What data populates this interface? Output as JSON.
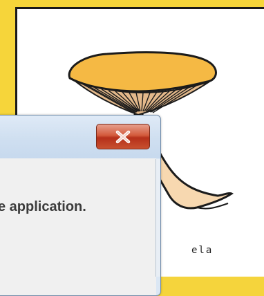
{
  "background": {
    "color": "#f6d53a"
  },
  "canvas": {
    "caption": "ela"
  },
  "dialog": {
    "close_icon": "close-icon",
    "message": "e application."
  }
}
